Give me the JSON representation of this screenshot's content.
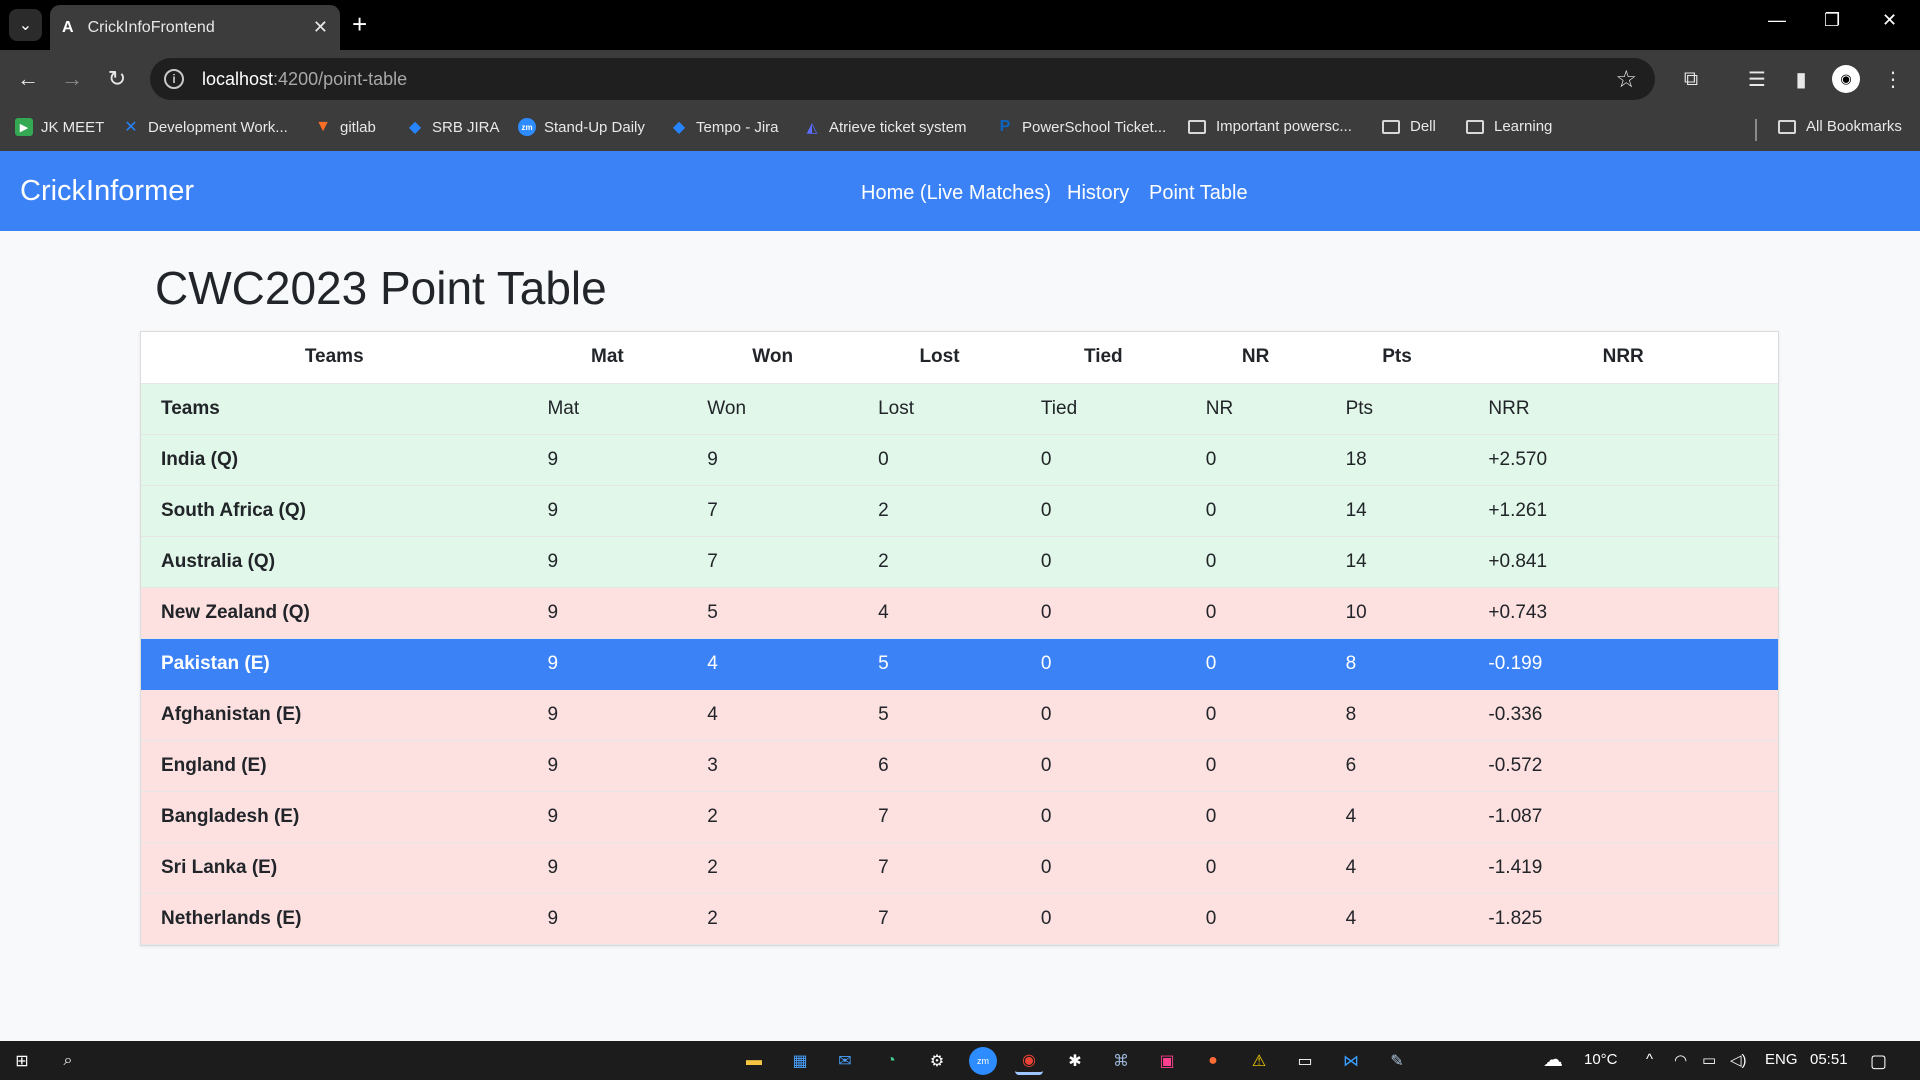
{
  "browser": {
    "tab_title": "CrickInfoFrontend",
    "tab_favicon": "A",
    "url_host": "localhost",
    "url_path": ":4200/point-table",
    "bookmarks": [
      {
        "label": "JK MEET",
        "icon": "meet-icon",
        "color": "#34a853"
      },
      {
        "label": "Development Work...",
        "icon": "confluence-icon",
        "color": "#2684ff"
      },
      {
        "label": "gitlab",
        "icon": "gitlab-icon",
        "color": "#fc6d26"
      },
      {
        "label": "SRB JIRA",
        "icon": "jira-icon",
        "color": "#2684ff"
      },
      {
        "label": "Stand-Up Daily",
        "icon": "zoom-icon",
        "color": "#2d8cff"
      },
      {
        "label": "Tempo - Jira",
        "icon": "jira-icon",
        "color": "#2684ff"
      },
      {
        "label": "Atrieve ticket system",
        "icon": "atrieve-icon",
        "color": "#5b6cff"
      },
      {
        "label": "PowerSchool Ticket...",
        "icon": "powerschool-icon",
        "color": "#0a66c2"
      },
      {
        "label": "Important powersc...",
        "icon": "folder-icon",
        "color": "#d8d8d8"
      },
      {
        "label": "Dell",
        "icon": "folder-icon",
        "color": "#d8d8d8"
      },
      {
        "label": "Learning",
        "icon": "folder-icon",
        "color": "#d8d8d8"
      }
    ],
    "all_bookmarks": "All Bookmarks"
  },
  "app": {
    "brand": "CrickInformer",
    "nav": [
      "Home (Live Matches)",
      "History",
      "Point Table"
    ],
    "accent_color": "#3b82f6",
    "page_title": "CWC2023 Point Table"
  },
  "table": {
    "columns": [
      "Teams",
      "Mat",
      "Won",
      "Lost",
      "Tied",
      "NR",
      "Pts",
      "NRR"
    ],
    "rows": [
      {
        "team": "Teams",
        "mat": "Mat",
        "won": "Won",
        "lost": "Lost",
        "tied": "Tied",
        "nr": "NR",
        "pts": "Pts",
        "nrr": "NRR",
        "status": "q"
      },
      {
        "team": "India (Q)",
        "mat": "9",
        "won": "9",
        "lost": "0",
        "tied": "0",
        "nr": "0",
        "pts": "18",
        "nrr": "+2.570",
        "status": "q"
      },
      {
        "team": "South Africa (Q)",
        "mat": "9",
        "won": "7",
        "lost": "2",
        "tied": "0",
        "nr": "0",
        "pts": "14",
        "nrr": "+1.261",
        "status": "q"
      },
      {
        "team": "Australia (Q)",
        "mat": "9",
        "won": "7",
        "lost": "2",
        "tied": "0",
        "nr": "0",
        "pts": "14",
        "nrr": "+0.841",
        "status": "q"
      },
      {
        "team": "New Zealand (Q)",
        "mat": "9",
        "won": "5",
        "lost": "4",
        "tied": "0",
        "nr": "0",
        "pts": "10",
        "nrr": "+0.743",
        "status": "e"
      },
      {
        "team": "Pakistan (E)",
        "mat": "9",
        "won": "4",
        "lost": "5",
        "tied": "0",
        "nr": "0",
        "pts": "8",
        "nrr": "-0.199",
        "status": "sel"
      },
      {
        "team": "Afghanistan (E)",
        "mat": "9",
        "won": "4",
        "lost": "5",
        "tied": "0",
        "nr": "0",
        "pts": "8",
        "nrr": "-0.336",
        "status": "e"
      },
      {
        "team": "England (E)",
        "mat": "9",
        "won": "3",
        "lost": "6",
        "tied": "0",
        "nr": "0",
        "pts": "6",
        "nrr": "-0.572",
        "status": "e"
      },
      {
        "team": "Bangladesh (E)",
        "mat": "9",
        "won": "2",
        "lost": "7",
        "tied": "0",
        "nr": "0",
        "pts": "4",
        "nrr": "-1.087",
        "status": "e"
      },
      {
        "team": "Sri Lanka (E)",
        "mat": "9",
        "won": "2",
        "lost": "7",
        "tied": "0",
        "nr": "0",
        "pts": "4",
        "nrr": "-1.419",
        "status": "e"
      },
      {
        "team": "Netherlands (E)",
        "mat": "9",
        "won": "2",
        "lost": "7",
        "tied": "0",
        "nr": "0",
        "pts": "4",
        "nrr": "-1.825",
        "status": "e"
      }
    ],
    "colors": {
      "qualified": "#e1f7e9",
      "eliminated": "#fde0e0",
      "selected": "#3b82f6"
    }
  },
  "taskbar": {
    "weather": "10°C",
    "language": "ENG",
    "time": "05:51"
  }
}
